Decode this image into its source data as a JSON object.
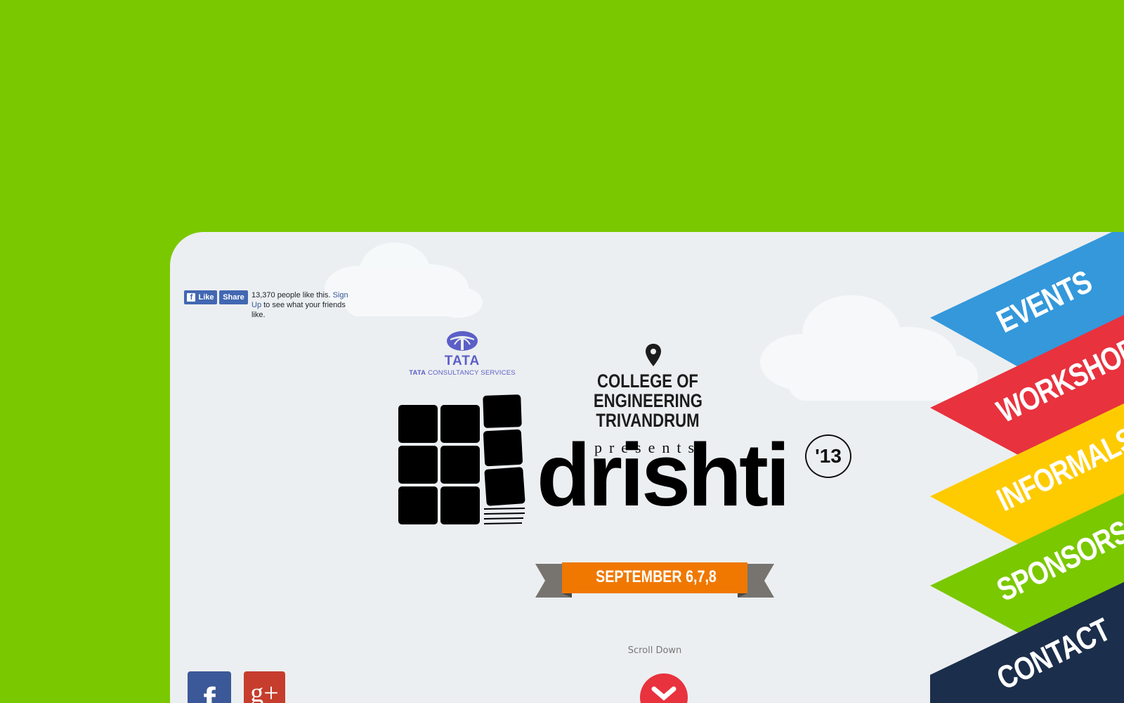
{
  "colors": {
    "background": "#7ac800",
    "panel": "#eceff1",
    "events": "#3498db",
    "workshops": "#e8323e",
    "informals": "#fecb00",
    "sponsors": "#7ac800",
    "contact": "#1b2e4b",
    "ribbon_orange": "#f07800",
    "ribbon_gray": "#777470"
  },
  "facebook_widget": {
    "like_label": "Like",
    "share_label": "Share",
    "count_text": "13,370 people like this.",
    "signup_link": "Sign Up",
    "suffix_text": "to see what your friends like."
  },
  "sponsor": {
    "brand": "TATA",
    "brand_short": "TATA",
    "subtitle": "CONSULTANCY SERVICES"
  },
  "host": {
    "college_line1": "COLLEGE OF",
    "college_line2": "ENGINEERING",
    "college_line3": "TRIVANDRUM",
    "presents": "presents"
  },
  "event": {
    "name": "drishti",
    "year": "'13",
    "dates": "SEPTEMBER  6,7,8"
  },
  "scroll": {
    "label": "Scroll Down",
    "icon": "chevron-down-icon"
  },
  "social": [
    {
      "name": "facebook",
      "glyph": "f"
    },
    {
      "name": "google-plus",
      "glyph": "g+"
    }
  ],
  "nav": [
    {
      "label": "EVENTS",
      "color": "#3498db"
    },
    {
      "label": "WORKSHOPS",
      "color": "#e8323e"
    },
    {
      "label": "INFORMALS",
      "color": "#fecb00"
    },
    {
      "label": "SPONSORS",
      "color": "#7ac800"
    },
    {
      "label": "CONTACT",
      "color": "#1b2e4b"
    }
  ]
}
